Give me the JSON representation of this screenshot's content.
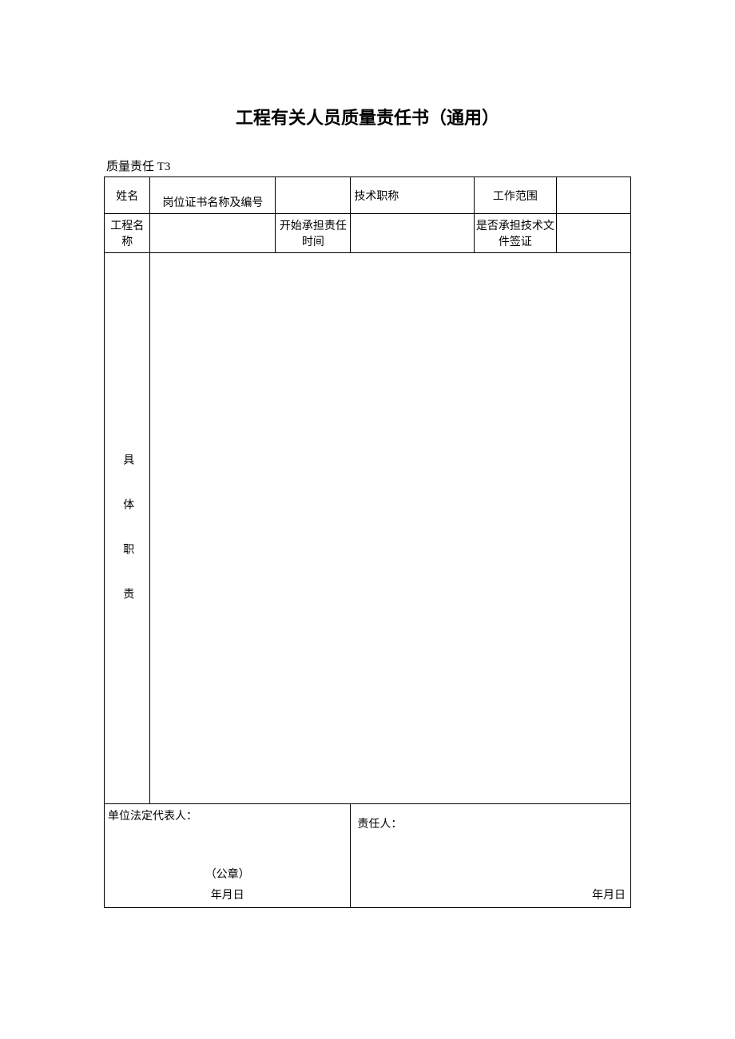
{
  "title": "工程有关人员质量责任书（通用）",
  "form_code": "质量责任 T3",
  "row1": {
    "name_label": "姓名",
    "cert_label": "岗位证书名称及编号",
    "tech_title_label": "技术职称",
    "scope_label": "工作范围"
  },
  "row2": {
    "project_label": "工程名称",
    "start_time_label": "开始承担责任时间",
    "tech_sign_label": "是否承担技术文件签证"
  },
  "body": {
    "duties_label": "具体职责"
  },
  "signature": {
    "left_label": "单位法定代表人：",
    "seal_label": "（公章）",
    "date_label": "年月日",
    "right_label": "责任人：",
    "right_date": "年月日"
  }
}
